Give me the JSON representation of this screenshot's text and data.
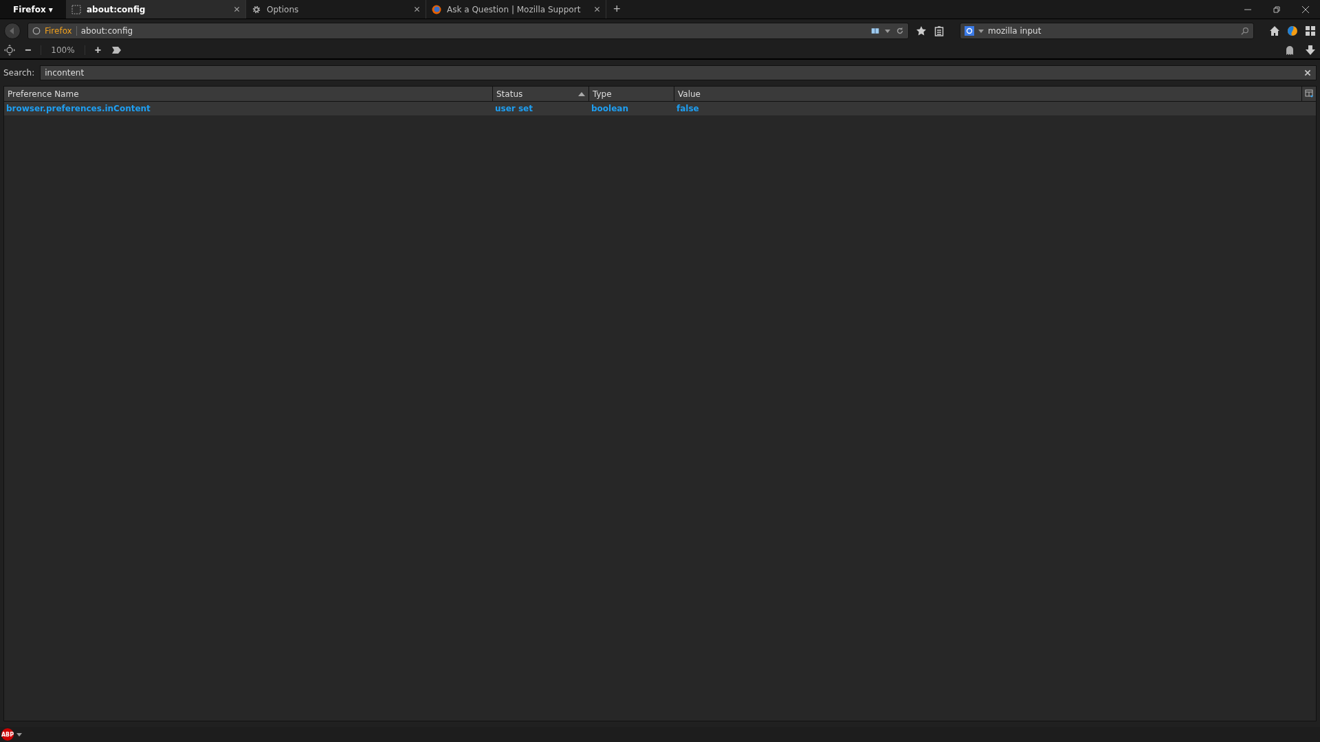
{
  "menu_button": {
    "label": "Firefox ▾"
  },
  "tabs": [
    {
      "title": "about:config",
      "kind": "page",
      "selected": true
    },
    {
      "title": "Options",
      "kind": "settings",
      "selected": false
    },
    {
      "title": "Ask a Question | Mozilla Support",
      "kind": "site",
      "selected": false
    }
  ],
  "new_tab": "+",
  "url_bar": {
    "identity": "Firefox",
    "url": "about:config"
  },
  "search_bar": {
    "value": "mozilla input"
  },
  "zoom": {
    "level_text": "100%",
    "minus": "−",
    "plus": "+"
  },
  "config_search": {
    "label": "Search:",
    "value": "incontent"
  },
  "table": {
    "columns": [
      {
        "label": "Preference Name",
        "sorted": false
      },
      {
        "label": "Status",
        "sorted": true
      },
      {
        "label": "Type",
        "sorted": false
      },
      {
        "label": "Value",
        "sorted": false
      }
    ],
    "rows": [
      {
        "cells": [
          "browser.preferences.inContent",
          "user set",
          "boolean",
          "false"
        ],
        "modified": true
      }
    ]
  },
  "status_bar": {
    "abp_label": "ABP"
  }
}
